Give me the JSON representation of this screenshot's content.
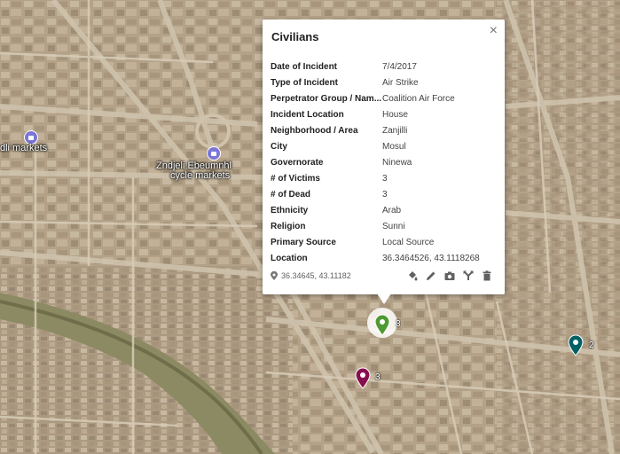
{
  "map": {
    "labels": [
      {
        "text": "Zndjeli Ebeumnhl"
      },
      {
        "text": "cycle markets"
      },
      {
        "text": "dli markets"
      }
    ],
    "markers": [
      {
        "color": "#4e9a32",
        "count": "3"
      },
      {
        "color": "#880e4f",
        "count": "3"
      },
      {
        "color": "#006064",
        "count": "2"
      }
    ]
  },
  "popup": {
    "title": "Civilians",
    "close_icon": "×",
    "rows": [
      {
        "key": "Date of Incident",
        "value": "7/4/2017"
      },
      {
        "key": "Type of Incident",
        "value": "Air Strike"
      },
      {
        "key": "Perpetrator Group / Nam...",
        "value": "Coalition Air Force"
      },
      {
        "key": "Incident Location",
        "value": "House"
      },
      {
        "key": "Neighborhood / Area",
        "value": "Zanjilli"
      },
      {
        "key": "City",
        "value": "Mosul"
      },
      {
        "key": "Governorate",
        "value": "Ninewa"
      },
      {
        "key": "# of Victims",
        "value": "3"
      },
      {
        "key": "# of Dead",
        "value": "3"
      },
      {
        "key": "Ethnicity",
        "value": "Arab"
      },
      {
        "key": "Religion",
        "value": "Sunni"
      },
      {
        "key": "Primary Source",
        "value": "Local Source"
      },
      {
        "key": "Location",
        "value": "36.3464526, 43.1118268"
      }
    ],
    "coordinates": "36.34645, 43.11182",
    "tools": [
      "paint-bucket-icon",
      "pencil-icon",
      "camera-icon",
      "directions-icon",
      "trash-icon"
    ]
  }
}
